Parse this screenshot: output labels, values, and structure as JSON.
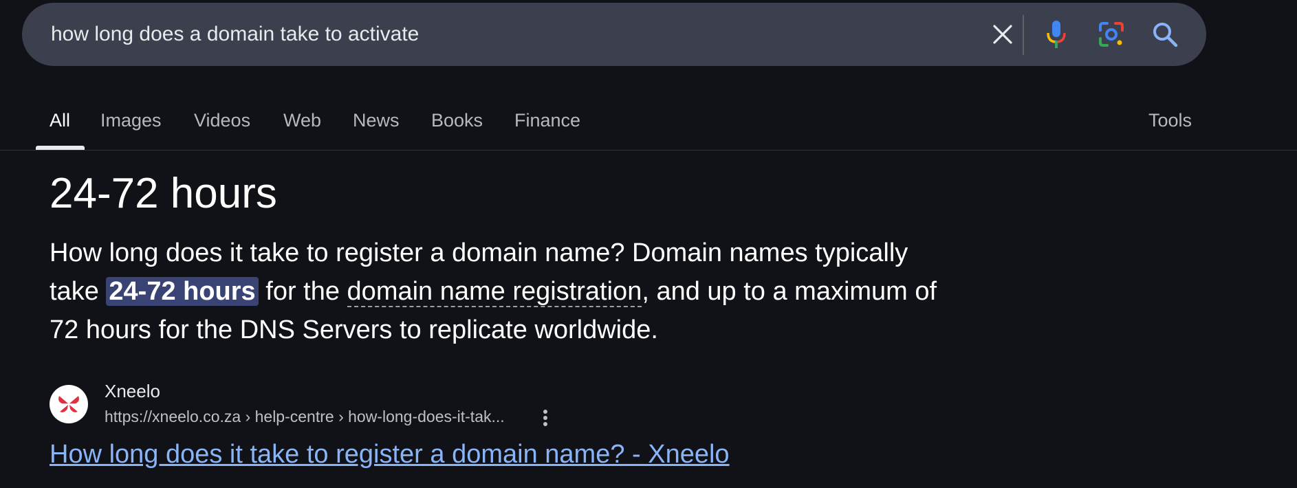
{
  "search": {
    "query": "how long does a domain take to activate"
  },
  "tabs": [
    {
      "label": "All",
      "active": true
    },
    {
      "label": "Images"
    },
    {
      "label": "Videos"
    },
    {
      "label": "Web"
    },
    {
      "label": "News"
    },
    {
      "label": "Books"
    },
    {
      "label": "Finance"
    }
  ],
  "tools_label": "Tools",
  "answer": {
    "title": "24-72 hours",
    "snippet_part1": "How long does it take to register a domain name? Domain names typically take ",
    "snippet_highlight": "24-72 hours",
    "snippet_part2": " for the ",
    "snippet_link": "domain name registration",
    "snippet_part3": ", and up to a maximum of 72 hours for the DNS Servers to replicate worldwide."
  },
  "source": {
    "site_name": "Xneelo",
    "url": "https://xneelo.co.za › help-centre › how-long-does-it-tak...",
    "link_title": "How long does it take to register a domain name? - Xneelo"
  },
  "colors": {
    "background": "#101218",
    "searchbar": "#3c3f4d",
    "highlight": "#394475",
    "link": "#8ab4f8",
    "favicon_accent": "#e0303f"
  },
  "icons": {
    "clear": "close-icon",
    "mic": "microphone-icon",
    "lens": "google-lens-icon",
    "search": "search-icon",
    "more": "more-vert-icon",
    "favicon": "xneelo-logo-icon"
  }
}
